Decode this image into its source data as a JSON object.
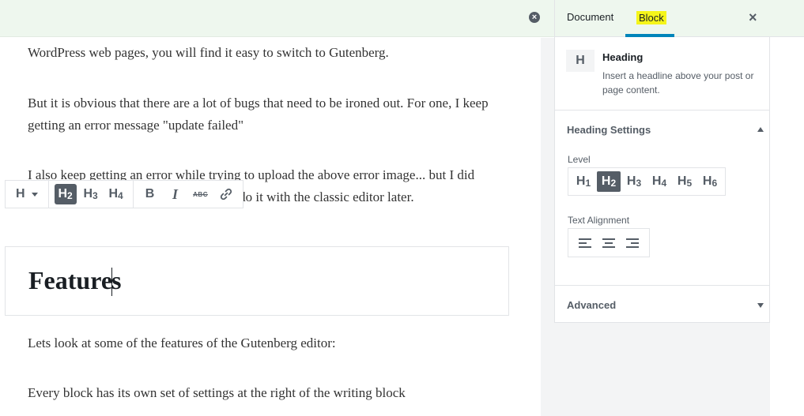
{
  "editor": {
    "paragraphs": [
      "WordPress web pages, you will find it easy to switch to Gutenberg.",
      "But it is obvious that there are a lot of bugs that need to be ironed out. For one, I keep getting an error message \"update failed\"",
      "I also keep getting an error while trying to upload the above error image... but I did upload other images earlier. Will try to do it with the classic editor later."
    ],
    "heading_text_before_caret": "Feature",
    "heading_text_after_caret": "s",
    "paragraphs_after": [
      "Lets look at some of the features of the Gutenberg editor:",
      "Every block has its own set of settings at the right of the writing block"
    ]
  },
  "notice": {
    "close_icon": "×"
  },
  "toolbar": {
    "switcher_label": "H",
    "h2": {
      "letter": "H",
      "level": "2"
    },
    "h3": {
      "letter": "H",
      "level": "3"
    },
    "h4": {
      "letter": "H",
      "level": "4"
    },
    "bold": "B",
    "italic": "I",
    "strikethrough": "ABC",
    "link_icon": "link-icon"
  },
  "sidebar": {
    "tabs": {
      "document": "Document",
      "block": "Block"
    },
    "close": "×",
    "block_card": {
      "icon_letter": "H",
      "title": "Heading",
      "description": "Insert a headline above your post or page content."
    },
    "heading_settings": {
      "title": "Heading Settings",
      "level_label": "Level",
      "levels": [
        {
          "letter": "H",
          "num": "1"
        },
        {
          "letter": "H",
          "num": "2"
        },
        {
          "letter": "H",
          "num": "3"
        },
        {
          "letter": "H",
          "num": "4"
        },
        {
          "letter": "H",
          "num": "5"
        },
        {
          "letter": "H",
          "num": "6"
        }
      ],
      "active_level": 2,
      "alignment_label": "Text Alignment"
    },
    "advanced": {
      "title": "Advanced"
    }
  },
  "colors": {
    "notice_bg": "#eef7ee",
    "tab_highlight": "#f5f51a",
    "tab_underline": "#0085ba",
    "active_button": "#555d66"
  }
}
